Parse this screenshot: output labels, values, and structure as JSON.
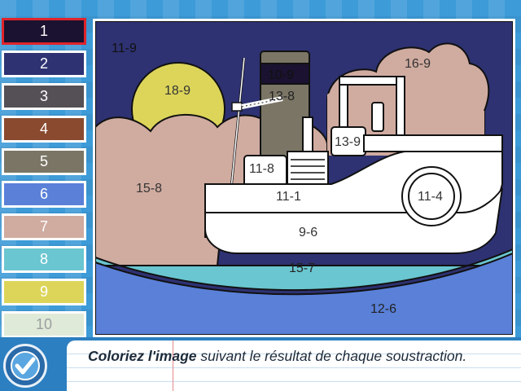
{
  "palette": [
    {
      "label": "1",
      "color": "#1a1230",
      "selected": true
    },
    {
      "label": "2",
      "color": "#2e3272"
    },
    {
      "label": "3",
      "color": "#555055"
    },
    {
      "label": "4",
      "color": "#8a4a30"
    },
    {
      "label": "5",
      "color": "#7a7565"
    },
    {
      "label": "6",
      "color": "#5a80d8"
    },
    {
      "label": "7",
      "color": "#d0aba0"
    },
    {
      "label": "8",
      "color": "#6ac6d0"
    },
    {
      "label": "9",
      "color": "#dcd55a"
    },
    {
      "label": "10",
      "color": "#e0ead8"
    }
  ],
  "picture_labels": {
    "sky": "11-9",
    "sun": "18-9",
    "cloud_left": "15-8",
    "cloud_right": "16-9",
    "funnel_top": "10-9",
    "funnel": "13-8",
    "cabin_left": "11-8",
    "crane_cabin": "13-9",
    "deck": "11-1",
    "porthole": "11-4",
    "hull": "9-6",
    "water_band": "15-7",
    "sea": "12-6"
  },
  "instruction": {
    "bold": "Coloriez l'image",
    "rest": "suivant le résultat de chaque soustraction."
  },
  "scene_colors": {
    "sky": "#2e3272",
    "sun": "#dcd55a",
    "clouds": "#d0aba0",
    "funnel": "#7a7565",
    "funnel_top": "#1a1230",
    "water_band": "#6ac6d0",
    "sea": "#5a80d8"
  },
  "icons": {
    "validate": "check-icon"
  }
}
